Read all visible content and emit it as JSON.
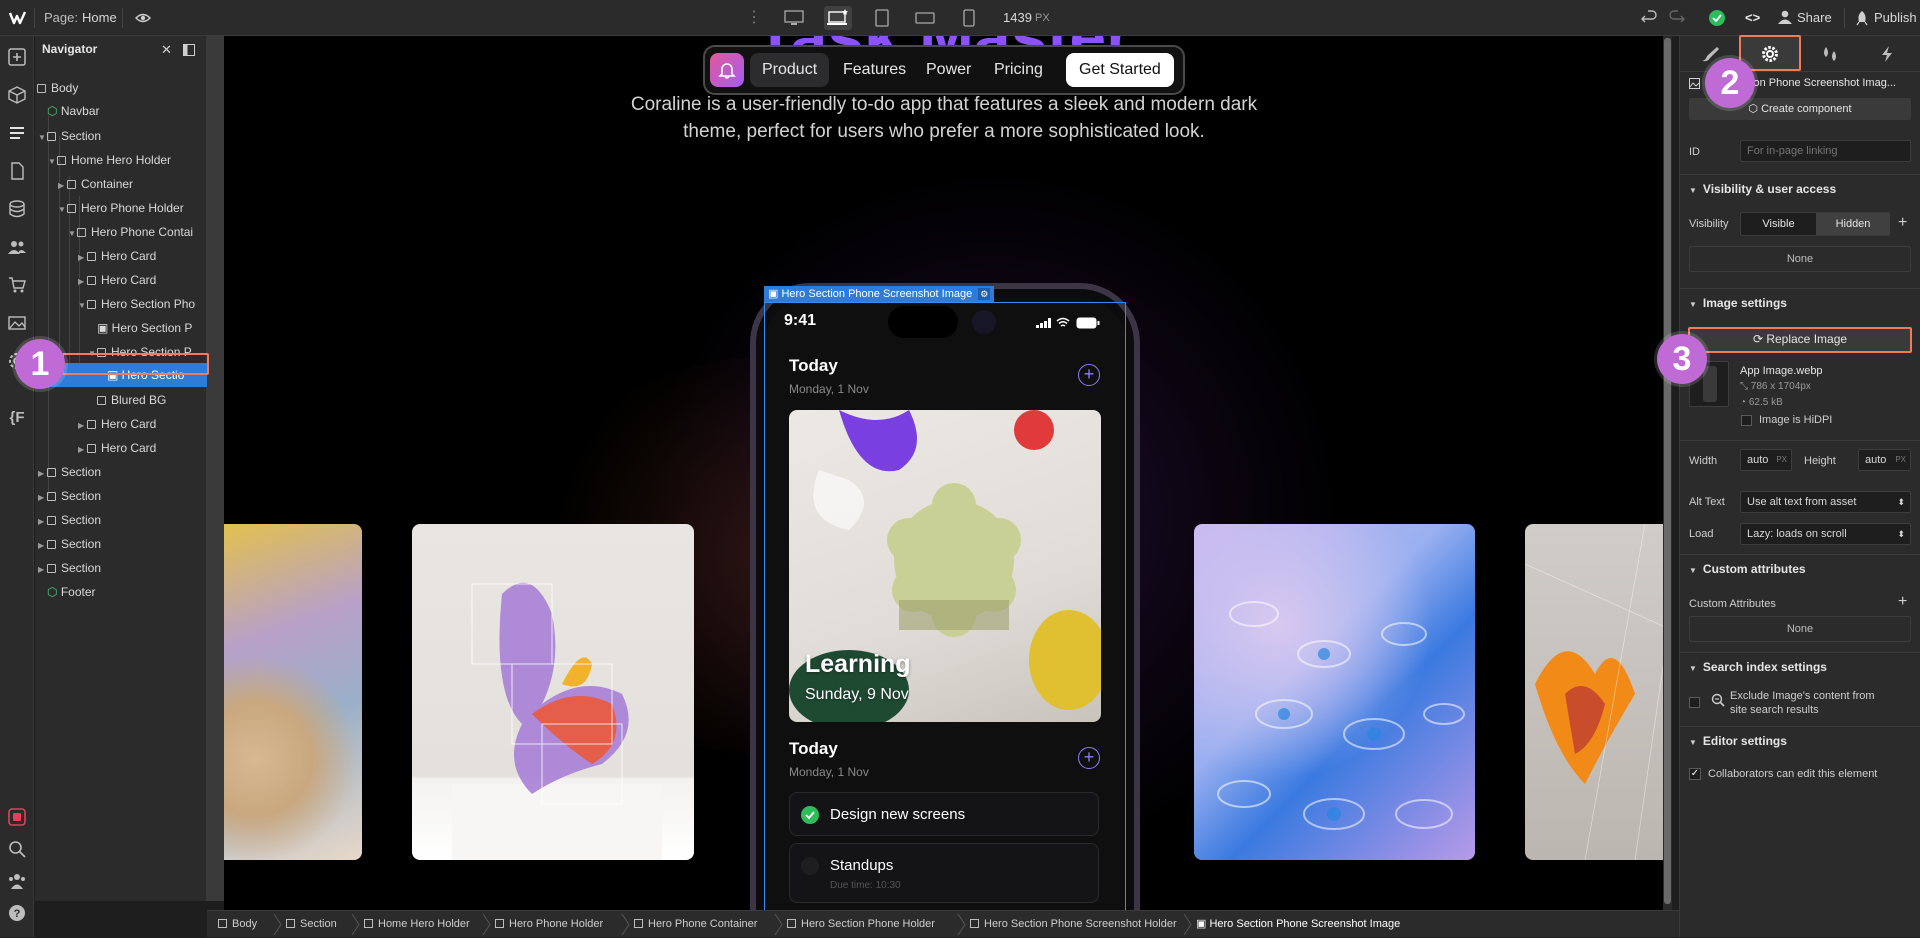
{
  "topbar": {
    "page_prefix": "Page:",
    "page_name": "Home",
    "width_value": "1439",
    "width_unit": "PX",
    "share_label": "Share",
    "publish_label": "Publish"
  },
  "navigator": {
    "title": "Navigator",
    "items": [
      {
        "label": "Body"
      },
      {
        "label": "Navbar"
      },
      {
        "label": "Section"
      },
      {
        "label": "Home Hero Holder"
      },
      {
        "label": "Container"
      },
      {
        "label": "Hero Phone Holder"
      },
      {
        "label": "Hero Phone Contai"
      },
      {
        "label": "Hero Card"
      },
      {
        "label": "Hero Card"
      },
      {
        "label": "Hero Section Pho"
      },
      {
        "label": "Hero Section P"
      },
      {
        "label": "Hero Section P"
      },
      {
        "label": "Hero Sectio"
      },
      {
        "label": "Blured BG"
      },
      {
        "label": "Hero Card"
      },
      {
        "label": "Hero Card"
      },
      {
        "label": "Section"
      },
      {
        "label": "Section"
      },
      {
        "label": "Section"
      },
      {
        "label": "Section"
      },
      {
        "label": "Section"
      },
      {
        "label": "Footer"
      }
    ]
  },
  "canvas": {
    "hero_title": "Task Master",
    "hero_description": "Coraline is a user-friendly to-do app that features a sleek and modern dark theme, perfect for users who prefer a more sophisticated look.",
    "navbar": {
      "links": [
        "Product",
        "Features",
        "Power",
        "Pricing"
      ],
      "cta": "Get Started"
    },
    "selection_label": "Hero Section Phone Screenshot Image",
    "phone": {
      "time": "9:41",
      "section1_title": "Today",
      "section1_date": "Monday, 1 Nov",
      "feature_title": "Learning",
      "feature_date": "Sunday, 9 Nov",
      "section2_title": "Today",
      "section2_date": "Monday, 1 Nov",
      "task1": "Design new screens",
      "task2": "Standups",
      "task2_sub": "Due time: 10:30"
    }
  },
  "right_panel": {
    "element_name": "tion Phone Screenshot Imag...",
    "create_component": "Create component",
    "id_label": "ID",
    "id_placeholder": "For in-page linking",
    "visibility_section": "Visibility & user access",
    "visibility_label": "Visibility",
    "visible_option": "Visible",
    "hidden_option": "Hidden",
    "none1": "None",
    "image_settings": "Image settings",
    "replace_image": "Replace Image",
    "file_name": "App Image.webp",
    "file_dims": "786 x 1704px",
    "file_size": "62.5 kB",
    "hidpi_label": "Image is HiDPI",
    "width_label": "Width",
    "width_value": "auto",
    "height_label": "Height",
    "height_value": "auto",
    "px_unit": "PX",
    "alt_label": "Alt Text",
    "alt_value": "Use alt text from asset",
    "load_label": "Load",
    "load_value": "Lazy: loads on scroll",
    "custom_attrs_section": "Custom attributes",
    "custom_attrs_label": "Custom Attributes",
    "none2": "None",
    "search_section": "Search index settings",
    "exclude_label_1": "Exclude Image's content from",
    "exclude_label_2": "site search results",
    "editor_section": "Editor settings",
    "collab_label": "Collaborators can edit this element"
  },
  "breadcrumbs": [
    "Body",
    "Section",
    "Home Hero Holder",
    "Hero Phone Holder",
    "Hero Phone Container",
    "Hero Section Phone Holder",
    "Hero Section Phone Screenshot Holder",
    "Hero Section Phone Screenshot Image"
  ],
  "annotations": [
    "1",
    "2",
    "3"
  ],
  "colors": {
    "accent": "#2f7bd8",
    "badge": "#c06ad6",
    "highlight": "#ef7c5a",
    "success": "#2dbd5a"
  }
}
